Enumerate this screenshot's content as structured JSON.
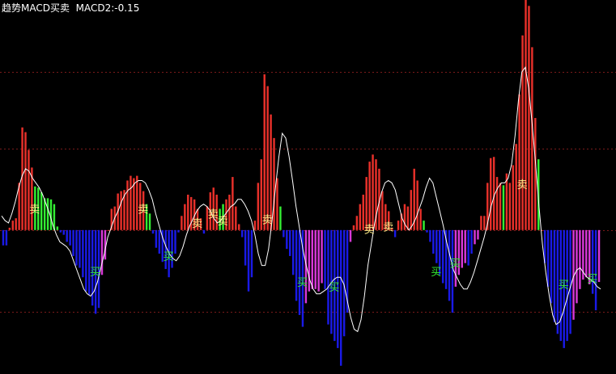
{
  "header": {
    "indicator_name": "趋势MACD买卖",
    "macd2_label": "MACD2:",
    "macd2_value": "-0.15"
  },
  "chart_data": {
    "type": "bar",
    "ylim": [
      -1.22,
      1.95
    ],
    "grid": "dotted horizontal",
    "gridlines": [
      1.34,
      0.69,
      0,
      -0.69
    ],
    "colors": {
      "positive_strong": "#e8302a",
      "positive_weak": "#33ee33",
      "negative_strong": "#1a1ae6",
      "negative_weak": "#d838d8",
      "signal_line": "#ffffff",
      "buy_text": "#33ee33",
      "sell_text": "#ffee88",
      "grid": "#7a1a1a"
    },
    "bars": [
      {
        "v": -0.13,
        "c": "negative_strong"
      },
      {
        "v": -0.13,
        "c": "negative_strong"
      },
      {
        "v": 0.02,
        "c": "positive_strong"
      },
      {
        "v": 0.08,
        "c": "positive_strong"
      },
      {
        "v": 0.1,
        "c": "positive_strong"
      },
      {
        "v": 0.4,
        "c": "positive_strong"
      },
      {
        "v": 0.87,
        "c": "positive_strong"
      },
      {
        "v": 0.83,
        "c": "positive_strong"
      },
      {
        "v": 0.68,
        "c": "positive_strong"
      },
      {
        "v": 0.53,
        "c": "positive_strong"
      },
      {
        "v": 0.37,
        "c": "positive_weak"
      },
      {
        "v": 0.36,
        "c": "positive_weak"
      },
      {
        "v": 0.32,
        "c": "positive_weak"
      },
      {
        "v": 0.27,
        "c": "positive_weak"
      },
      {
        "v": 0.27,
        "c": "positive_weak"
      },
      {
        "v": 0.26,
        "c": "positive_weak"
      },
      {
        "v": 0.22,
        "c": "positive_weak"
      },
      {
        "v": 0.03,
        "c": "positive_weak"
      },
      {
        "v": -0.02,
        "c": "negative_strong"
      },
      {
        "v": -0.04,
        "c": "negative_strong"
      },
      {
        "v": -0.1,
        "c": "negative_strong"
      },
      {
        "v": -0.13,
        "c": "negative_strong"
      },
      {
        "v": -0.22,
        "c": "negative_strong"
      },
      {
        "v": -0.3,
        "c": "negative_strong"
      },
      {
        "v": -0.32,
        "c": "negative_strong"
      },
      {
        "v": -0.4,
        "c": "negative_strong"
      },
      {
        "v": -0.52,
        "c": "negative_strong"
      },
      {
        "v": -0.55,
        "c": "negative_strong"
      },
      {
        "v": -0.64,
        "c": "negative_strong"
      },
      {
        "v": -0.71,
        "c": "negative_strong"
      },
      {
        "v": -0.66,
        "c": "negative_strong"
      },
      {
        "v": -0.38,
        "c": "negative_weak"
      },
      {
        "v": -0.25,
        "c": "negative_weak"
      },
      {
        "v": 0.0,
        "c": "positive_strong"
      },
      {
        "v": 0.18,
        "c": "positive_strong"
      },
      {
        "v": 0.2,
        "c": "positive_strong"
      },
      {
        "v": 0.31,
        "c": "positive_strong"
      },
      {
        "v": 0.33,
        "c": "positive_strong"
      },
      {
        "v": 0.34,
        "c": "positive_strong"
      },
      {
        "v": 0.42,
        "c": "positive_strong"
      },
      {
        "v": 0.46,
        "c": "positive_strong"
      },
      {
        "v": 0.44,
        "c": "positive_strong"
      },
      {
        "v": 0.46,
        "c": "positive_strong"
      },
      {
        "v": 0.4,
        "c": "positive_strong"
      },
      {
        "v": 0.33,
        "c": "positive_strong"
      },
      {
        "v": 0.22,
        "c": "positive_weak"
      },
      {
        "v": 0.14,
        "c": "positive_weak"
      },
      {
        "v": -0.03,
        "c": "negative_strong"
      },
      {
        "v": -0.15,
        "c": "negative_strong"
      },
      {
        "v": -0.2,
        "c": "negative_strong"
      },
      {
        "v": -0.27,
        "c": "negative_strong"
      },
      {
        "v": -0.33,
        "c": "negative_strong"
      },
      {
        "v": -0.4,
        "c": "negative_strong"
      },
      {
        "v": -0.32,
        "c": "negative_strong"
      },
      {
        "v": -0.2,
        "c": "negative_strong"
      },
      {
        "v": -0.02,
        "c": "negative_strong"
      },
      {
        "v": 0.12,
        "c": "positive_strong"
      },
      {
        "v": 0.22,
        "c": "positive_strong"
      },
      {
        "v": 0.3,
        "c": "positive_strong"
      },
      {
        "v": 0.28,
        "c": "positive_strong"
      },
      {
        "v": 0.26,
        "c": "positive_strong"
      },
      {
        "v": 0.18,
        "c": "positive_strong"
      },
      {
        "v": 0.1,
        "c": "positive_strong"
      },
      {
        "v": -0.03,
        "c": "negative_strong"
      },
      {
        "v": 0.2,
        "c": "positive_strong"
      },
      {
        "v": 0.32,
        "c": "positive_strong"
      },
      {
        "v": 0.36,
        "c": "positive_strong"
      },
      {
        "v": 0.3,
        "c": "positive_strong"
      },
      {
        "v": 0.18,
        "c": "positive_weak"
      },
      {
        "v": 0.22,
        "c": "positive_weak"
      },
      {
        "v": 0.26,
        "c": "positive_strong"
      },
      {
        "v": 0.3,
        "c": "positive_strong"
      },
      {
        "v": 0.45,
        "c": "positive_strong"
      },
      {
        "v": 0.2,
        "c": "positive_strong"
      },
      {
        "v": 0.05,
        "c": "positive_strong"
      },
      {
        "v": -0.06,
        "c": "negative_strong"
      },
      {
        "v": -0.3,
        "c": "negative_strong"
      },
      {
        "v": -0.52,
        "c": "negative_strong"
      },
      {
        "v": -0.4,
        "c": "negative_strong"
      },
      {
        "v": 0.08,
        "c": "positive_strong"
      },
      {
        "v": 0.4,
        "c": "positive_strong"
      },
      {
        "v": 0.6,
        "c": "positive_strong"
      },
      {
        "v": 1.32,
        "c": "positive_strong"
      },
      {
        "v": 1.22,
        "c": "positive_strong"
      },
      {
        "v": 0.98,
        "c": "positive_strong"
      },
      {
        "v": 0.78,
        "c": "positive_strong"
      },
      {
        "v": 0.44,
        "c": "positive_strong"
      },
      {
        "v": 0.2,
        "c": "positive_weak"
      },
      {
        "v": -0.06,
        "c": "negative_strong"
      },
      {
        "v": -0.16,
        "c": "negative_strong"
      },
      {
        "v": -0.22,
        "c": "negative_strong"
      },
      {
        "v": -0.38,
        "c": "negative_strong"
      },
      {
        "v": -0.6,
        "c": "negative_strong"
      },
      {
        "v": -0.72,
        "c": "negative_strong"
      },
      {
        "v": -0.82,
        "c": "negative_strong"
      },
      {
        "v": -0.62,
        "c": "negative_weak"
      },
      {
        "v": -0.52,
        "c": "negative_weak"
      },
      {
        "v": -0.5,
        "c": "negative_weak"
      },
      {
        "v": -0.5,
        "c": "negative_weak"
      },
      {
        "v": -0.52,
        "c": "negative_weak"
      },
      {
        "v": -0.45,
        "c": "negative_weak"
      },
      {
        "v": -0.5,
        "c": "negative_strong"
      },
      {
        "v": -0.8,
        "c": "negative_strong"
      },
      {
        "v": -0.88,
        "c": "negative_strong"
      },
      {
        "v": -0.94,
        "c": "negative_strong"
      },
      {
        "v": -1.0,
        "c": "negative_strong"
      },
      {
        "v": -1.15,
        "c": "negative_strong"
      },
      {
        "v": -0.9,
        "c": "negative_strong"
      },
      {
        "v": -0.7,
        "c": "negative_strong"
      },
      {
        "v": -0.1,
        "c": "negative_weak"
      },
      {
        "v": 0.04,
        "c": "positive_strong"
      },
      {
        "v": 0.12,
        "c": "positive_strong"
      },
      {
        "v": 0.22,
        "c": "positive_strong"
      },
      {
        "v": 0.3,
        "c": "positive_strong"
      },
      {
        "v": 0.45,
        "c": "positive_strong"
      },
      {
        "v": 0.58,
        "c": "positive_strong"
      },
      {
        "v": 0.64,
        "c": "positive_strong"
      },
      {
        "v": 0.6,
        "c": "positive_strong"
      },
      {
        "v": 0.52,
        "c": "positive_strong"
      },
      {
        "v": 0.33,
        "c": "positive_strong"
      },
      {
        "v": 0.22,
        "c": "positive_strong"
      },
      {
        "v": 0.16,
        "c": "positive_strong"
      },
      {
        "v": 0.02,
        "c": "positive_strong"
      },
      {
        "v": -0.06,
        "c": "negative_strong"
      },
      {
        "v": 0.08,
        "c": "positive_strong"
      },
      {
        "v": 0.14,
        "c": "positive_strong"
      },
      {
        "v": 0.22,
        "c": "positive_strong"
      },
      {
        "v": 0.2,
        "c": "positive_strong"
      },
      {
        "v": 0.34,
        "c": "positive_strong"
      },
      {
        "v": 0.52,
        "c": "positive_strong"
      },
      {
        "v": 0.42,
        "c": "positive_strong"
      },
      {
        "v": 0.18,
        "c": "positive_strong"
      },
      {
        "v": 0.08,
        "c": "positive_weak"
      },
      {
        "v": -0.02,
        "c": "negative_strong"
      },
      {
        "v": -0.1,
        "c": "negative_strong"
      },
      {
        "v": -0.2,
        "c": "negative_strong"
      },
      {
        "v": -0.28,
        "c": "negative_strong"
      },
      {
        "v": -0.38,
        "c": "negative_strong"
      },
      {
        "v": -0.45,
        "c": "negative_strong"
      },
      {
        "v": -0.5,
        "c": "negative_strong"
      },
      {
        "v": -0.6,
        "c": "negative_strong"
      },
      {
        "v": -0.7,
        "c": "negative_strong"
      },
      {
        "v": -0.48,
        "c": "negative_weak"
      },
      {
        "v": -0.38,
        "c": "negative_weak"
      },
      {
        "v": -0.32,
        "c": "negative_weak"
      },
      {
        "v": -0.28,
        "c": "negative_weak"
      },
      {
        "v": -0.3,
        "c": "negative_strong"
      },
      {
        "v": -0.2,
        "c": "negative_strong"
      },
      {
        "v": -0.12,
        "c": "negative_weak"
      },
      {
        "v": -0.08,
        "c": "negative_weak"
      },
      {
        "v": 0.12,
        "c": "positive_strong"
      },
      {
        "v": 0.12,
        "c": "positive_strong"
      },
      {
        "v": 0.4,
        "c": "positive_strong"
      },
      {
        "v": 0.61,
        "c": "positive_strong"
      },
      {
        "v": 0.62,
        "c": "positive_strong"
      },
      {
        "v": 0.45,
        "c": "positive_strong"
      },
      {
        "v": 0.4,
        "c": "positive_strong"
      },
      {
        "v": 0.38,
        "c": "positive_weak"
      },
      {
        "v": 0.48,
        "c": "positive_strong"
      },
      {
        "v": 0.4,
        "c": "positive_strong"
      },
      {
        "v": 0.55,
        "c": "positive_strong"
      },
      {
        "v": 0.73,
        "c": "positive_strong"
      },
      {
        "v": 1.15,
        "c": "positive_strong"
      },
      {
        "v": 1.65,
        "c": "positive_strong"
      },
      {
        "v": 2.0,
        "c": "positive_strong"
      },
      {
        "v": 1.9,
        "c": "positive_strong"
      },
      {
        "v": 1.55,
        "c": "positive_strong"
      },
      {
        "v": 0.95,
        "c": "positive_strong"
      },
      {
        "v": 0.6,
        "c": "positive_weak"
      },
      {
        "v": 0.0,
        "c": "positive_strong"
      },
      {
        "v": -0.28,
        "c": "negative_strong"
      },
      {
        "v": -0.48,
        "c": "negative_strong"
      },
      {
        "v": -0.62,
        "c": "negative_strong"
      },
      {
        "v": -0.78,
        "c": "negative_strong"
      },
      {
        "v": -0.88,
        "c": "negative_strong"
      },
      {
        "v": -0.94,
        "c": "negative_strong"
      },
      {
        "v": -1.0,
        "c": "negative_strong"
      },
      {
        "v": -0.94,
        "c": "negative_strong"
      },
      {
        "v": -0.88,
        "c": "negative_strong"
      },
      {
        "v": -0.76,
        "c": "negative_weak"
      },
      {
        "v": -0.62,
        "c": "negative_weak"
      },
      {
        "v": -0.5,
        "c": "negative_weak"
      },
      {
        "v": -0.42,
        "c": "negative_weak"
      },
      {
        "v": -0.4,
        "c": "negative_weak"
      },
      {
        "v": -0.46,
        "c": "negative_weak"
      },
      {
        "v": -0.54,
        "c": "negative_strong"
      },
      {
        "v": -0.68,
        "c": "negative_strong"
      },
      {
        "v": -0.44,
        "c": "negative_weak"
      }
    ],
    "signal_line": [
      0.12,
      0.08,
      0.06,
      0.14,
      0.24,
      0.36,
      0.46,
      0.52,
      0.5,
      0.44,
      0.4,
      0.36,
      0.3,
      0.22,
      0.14,
      0.04,
      -0.04,
      -0.1,
      -0.12,
      -0.14,
      -0.18,
      -0.26,
      -0.34,
      -0.42,
      -0.5,
      -0.54,
      -0.56,
      -0.52,
      -0.44,
      -0.32,
      -0.2,
      -0.06,
      0.02,
      0.1,
      0.16,
      0.24,
      0.3,
      0.34,
      0.36,
      0.4,
      0.42,
      0.42,
      0.4,
      0.34,
      0.26,
      0.14,
      0.04,
      -0.06,
      -0.14,
      -0.2,
      -0.24,
      -0.26,
      -0.22,
      -0.14,
      -0.04,
      0.04,
      0.1,
      0.16,
      0.2,
      0.22,
      0.2,
      0.16,
      0.1,
      0.06,
      0.08,
      0.12,
      0.16,
      0.2,
      0.22,
      0.26,
      0.26,
      0.22,
      0.16,
      0.08,
      -0.04,
      -0.2,
      -0.3,
      -0.3,
      -0.16,
      0.08,
      0.36,
      0.62,
      0.82,
      0.78,
      0.62,
      0.42,
      0.2,
      0.02,
      -0.16,
      -0.3,
      -0.42,
      -0.5,
      -0.54,
      -0.54,
      -0.52,
      -0.5,
      -0.46,
      -0.42,
      -0.4,
      -0.4,
      -0.46,
      -0.6,
      -0.74,
      -0.84,
      -0.86,
      -0.76,
      -0.56,
      -0.3,
      -0.12,
      0.06,
      0.2,
      0.32,
      0.4,
      0.42,
      0.4,
      0.34,
      0.22,
      0.1,
      0.04,
      0.0,
      0.04,
      0.1,
      0.18,
      0.26,
      0.36,
      0.44,
      0.4,
      0.28,
      0.16,
      0.04,
      -0.1,
      -0.22,
      -0.34,
      -0.4,
      -0.46,
      -0.5,
      -0.5,
      -0.44,
      -0.36,
      -0.26,
      -0.16,
      -0.06,
      0.06,
      0.2,
      0.3,
      0.36,
      0.4,
      0.4,
      0.44,
      0.56,
      0.8,
      1.1,
      1.34,
      1.38,
      1.2,
      0.9,
      0.56,
      0.2,
      -0.12,
      -0.36,
      -0.56,
      -0.72,
      -0.8,
      -0.78,
      -0.7,
      -0.6,
      -0.5,
      -0.4,
      -0.34,
      -0.32,
      -0.36,
      -0.4,
      -0.42,
      -0.44,
      -0.48,
      -0.5
    ],
    "signals": [
      {
        "label": "卖",
        "type": "sell",
        "bar": 10,
        "level": 0.18
      },
      {
        "label": "买",
        "type": "buy",
        "bar": 29,
        "level": -0.35
      },
      {
        "label": "卖",
        "type": "sell",
        "bar": 44,
        "level": 0.18
      },
      {
        "label": "买",
        "type": "buy",
        "bar": 52,
        "level": -0.22
      },
      {
        "label": "卖",
        "type": "sell",
        "bar": 61,
        "level": 0.06
      },
      {
        "label": "卖",
        "type": "sell",
        "bar": 66,
        "level": 0.14
      },
      {
        "label": "卖",
        "type": "sell",
        "bar": 69,
        "level": 0.08
      },
      {
        "label": "卖",
        "type": "sell",
        "bar": 83,
        "level": 0.09
      },
      {
        "label": "买",
        "type": "buy",
        "bar": 94,
        "level": -0.44
      },
      {
        "label": "买",
        "type": "buy",
        "bar": 104,
        "level": -0.48
      },
      {
        "label": "卖",
        "type": "sell",
        "bar": 115,
        "level": 0.01
      },
      {
        "label": "卖",
        "type": "sell",
        "bar": 121,
        "level": 0.03
      },
      {
        "label": "买",
        "type": "buy",
        "bar": 136,
        "level": -0.35
      },
      {
        "label": "买",
        "type": "buy",
        "bar": 142,
        "level": -0.28
      },
      {
        "label": "卖",
        "type": "sell",
        "bar": 163,
        "level": 0.39
      },
      {
        "label": "买",
        "type": "buy",
        "bar": 176,
        "level": -0.46
      },
      {
        "label": "买",
        "type": "buy",
        "bar": 185,
        "level": -0.41
      }
    ]
  }
}
